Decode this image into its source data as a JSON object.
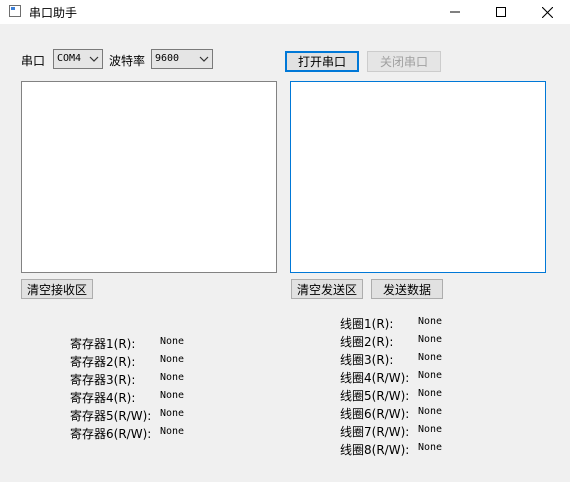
{
  "window": {
    "title": "串口助手",
    "controls": [
      "minimize-icon",
      "maximize-icon",
      "close-icon"
    ]
  },
  "serial": {
    "port_label": "串口",
    "port_value": "COM4",
    "baud_label": "波特率",
    "baud_value": "9600",
    "open_button": "打开串口",
    "close_button": "关闭串口"
  },
  "receive": {
    "clear_button": "清空接收区"
  },
  "send": {
    "clear_button": "清空发送区",
    "send_button": "发送数据"
  },
  "registers": [
    {
      "label": "寄存器1(R):",
      "value": "None"
    },
    {
      "label": "寄存器2(R):",
      "value": "None"
    },
    {
      "label": "寄存器3(R):",
      "value": "None"
    },
    {
      "label": "寄存器4(R):",
      "value": "None"
    },
    {
      "label": "寄存器5(R/W):",
      "value": "None"
    },
    {
      "label": "寄存器6(R/W):",
      "value": "None"
    }
  ],
  "coils": [
    {
      "label": "线圈1(R):",
      "value": "None"
    },
    {
      "label": "线圈2(R):",
      "value": "None"
    },
    {
      "label": "线圈3(R):",
      "value": "None"
    },
    {
      "label": "线圈4(R/W):",
      "value": "None"
    },
    {
      "label": "线圈5(R/W):",
      "value": "None"
    },
    {
      "label": "线圈6(R/W):",
      "value": "None"
    },
    {
      "label": "线圈7(R/W):",
      "value": "None"
    },
    {
      "label": "线圈8(R/W):",
      "value": "None"
    }
  ],
  "colors": {
    "background": "#f0f0f0",
    "focus_border": "#0078d7",
    "disabled_text": "#a0a0a0"
  }
}
